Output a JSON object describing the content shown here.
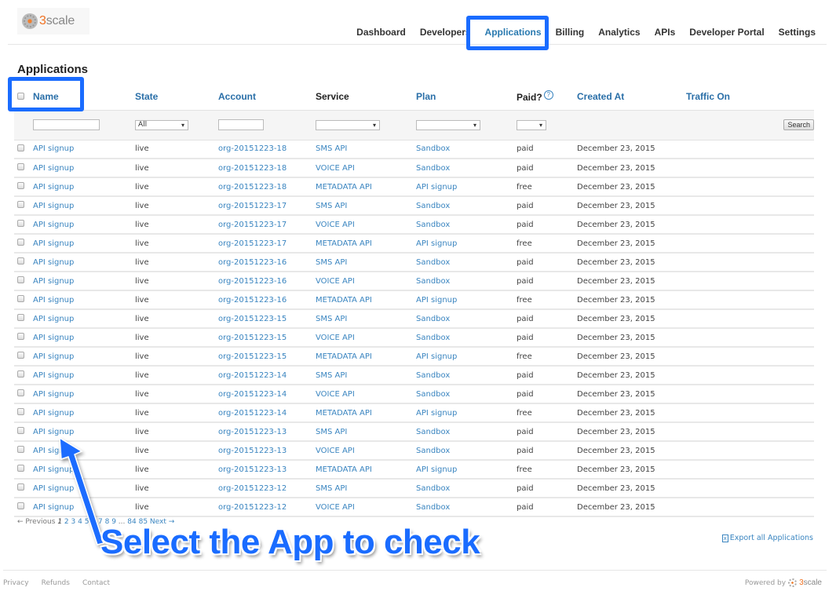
{
  "brand": {
    "logo_text_prefix": "3",
    "logo_text_suffix": "scale"
  },
  "topnav": [
    {
      "label": "Dashboard",
      "active": false
    },
    {
      "label": "Developers",
      "active": false
    },
    {
      "label": "Applications",
      "active": true
    },
    {
      "label": "Billing",
      "active": false
    },
    {
      "label": "Analytics",
      "active": false
    },
    {
      "label": "APIs",
      "active": false
    },
    {
      "label": "Developer Portal",
      "active": false
    },
    {
      "label": "Settings",
      "active": false
    }
  ],
  "page": {
    "title": "Applications"
  },
  "table": {
    "headers": {
      "name": "Name",
      "state": "State",
      "account": "Account",
      "service": "Service",
      "plan": "Plan",
      "paid": "Paid?",
      "paid_help": "?",
      "created_at": "Created At",
      "traffic_on": "Traffic On"
    },
    "filters": {
      "name_value": "",
      "state_selected": "All",
      "account_value": "",
      "service_selected": "",
      "plan_selected": "",
      "paid_selected": "",
      "search_label": "Search"
    },
    "rows": [
      {
        "name": "API signup",
        "state": "live",
        "account": "org-20151223-18",
        "service": "SMS API",
        "plan": "Sandbox",
        "paid": "paid",
        "created_at": "December 23, 2015",
        "traffic_on": ""
      },
      {
        "name": "API signup",
        "state": "live",
        "account": "org-20151223-18",
        "service": "VOICE API",
        "plan": "Sandbox",
        "paid": "paid",
        "created_at": "December 23, 2015",
        "traffic_on": ""
      },
      {
        "name": "API signup",
        "state": "live",
        "account": "org-20151223-18",
        "service": "METADATA API",
        "plan": "API signup",
        "paid": "free",
        "created_at": "December 23, 2015",
        "traffic_on": ""
      },
      {
        "name": "API signup",
        "state": "live",
        "account": "org-20151223-17",
        "service": "SMS API",
        "plan": "Sandbox",
        "paid": "paid",
        "created_at": "December 23, 2015",
        "traffic_on": ""
      },
      {
        "name": "API signup",
        "state": "live",
        "account": "org-20151223-17",
        "service": "VOICE API",
        "plan": "Sandbox",
        "paid": "paid",
        "created_at": "December 23, 2015",
        "traffic_on": ""
      },
      {
        "name": "API signup",
        "state": "live",
        "account": "org-20151223-17",
        "service": "METADATA API",
        "plan": "API signup",
        "paid": "free",
        "created_at": "December 23, 2015",
        "traffic_on": ""
      },
      {
        "name": "API signup",
        "state": "live",
        "account": "org-20151223-16",
        "service": "SMS API",
        "plan": "Sandbox",
        "paid": "paid",
        "created_at": "December 23, 2015",
        "traffic_on": ""
      },
      {
        "name": "API signup",
        "state": "live",
        "account": "org-20151223-16",
        "service": "VOICE API",
        "plan": "Sandbox",
        "paid": "paid",
        "created_at": "December 23, 2015",
        "traffic_on": ""
      },
      {
        "name": "API signup",
        "state": "live",
        "account": "org-20151223-16",
        "service": "METADATA API",
        "plan": "API signup",
        "paid": "free",
        "created_at": "December 23, 2015",
        "traffic_on": ""
      },
      {
        "name": "API signup",
        "state": "live",
        "account": "org-20151223-15",
        "service": "SMS API",
        "plan": "Sandbox",
        "paid": "paid",
        "created_at": "December 23, 2015",
        "traffic_on": ""
      },
      {
        "name": "API signup",
        "state": "live",
        "account": "org-20151223-15",
        "service": "VOICE API",
        "plan": "Sandbox",
        "paid": "paid",
        "created_at": "December 23, 2015",
        "traffic_on": ""
      },
      {
        "name": "API signup",
        "state": "live",
        "account": "org-20151223-15",
        "service": "METADATA API",
        "plan": "API signup",
        "paid": "free",
        "created_at": "December 23, 2015",
        "traffic_on": ""
      },
      {
        "name": "API signup",
        "state": "live",
        "account": "org-20151223-14",
        "service": "SMS API",
        "plan": "Sandbox",
        "paid": "paid",
        "created_at": "December 23, 2015",
        "traffic_on": ""
      },
      {
        "name": "API signup",
        "state": "live",
        "account": "org-20151223-14",
        "service": "VOICE API",
        "plan": "Sandbox",
        "paid": "paid",
        "created_at": "December 23, 2015",
        "traffic_on": ""
      },
      {
        "name": "API signup",
        "state": "live",
        "account": "org-20151223-14",
        "service": "METADATA API",
        "plan": "API signup",
        "paid": "free",
        "created_at": "December 23, 2015",
        "traffic_on": ""
      },
      {
        "name": "API signup",
        "state": "live",
        "account": "org-20151223-13",
        "service": "SMS API",
        "plan": "Sandbox",
        "paid": "paid",
        "created_at": "December 23, 2015",
        "traffic_on": ""
      },
      {
        "name": "API signup",
        "state": "live",
        "account": "org-20151223-13",
        "service": "VOICE API",
        "plan": "Sandbox",
        "paid": "paid",
        "created_at": "December 23, 2015",
        "traffic_on": ""
      },
      {
        "name": "API signup",
        "state": "live",
        "account": "org-20151223-13",
        "service": "METADATA API",
        "plan": "API signup",
        "paid": "free",
        "created_at": "December 23, 2015",
        "traffic_on": ""
      },
      {
        "name": "API signup",
        "state": "live",
        "account": "org-20151223-12",
        "service": "SMS API",
        "plan": "Sandbox",
        "paid": "paid",
        "created_at": "December 23, 2015",
        "traffic_on": ""
      },
      {
        "name": "API signup",
        "state": "live",
        "account": "org-20151223-12",
        "service": "VOICE API",
        "plan": "Sandbox",
        "paid": "paid",
        "created_at": "December 23, 2015",
        "traffic_on": ""
      }
    ]
  },
  "pagination": {
    "previous": "← Previous",
    "current": "1",
    "pages": [
      "2",
      "3",
      "4",
      "5",
      "6",
      "7",
      "8",
      "9"
    ],
    "ellipsis": "...",
    "last_pages": [
      "84",
      "85"
    ],
    "next": "Next →"
  },
  "export": {
    "label": "Export all Applications",
    "icon": "spreadsheet-icon"
  },
  "footer": {
    "links": [
      "Privacy",
      "Refunds",
      "Contact"
    ],
    "powered_by": "Powered by",
    "powered_brand_prefix": "3",
    "powered_brand_suffix": "scale"
  },
  "annotation": {
    "text": "Select the App to check",
    "color": "#1a6cff"
  },
  "colors": {
    "link": "#3a85c0",
    "header_link": "#2a6fa8",
    "highlight": "#1a6cff",
    "brand_orange": "#f07020"
  }
}
